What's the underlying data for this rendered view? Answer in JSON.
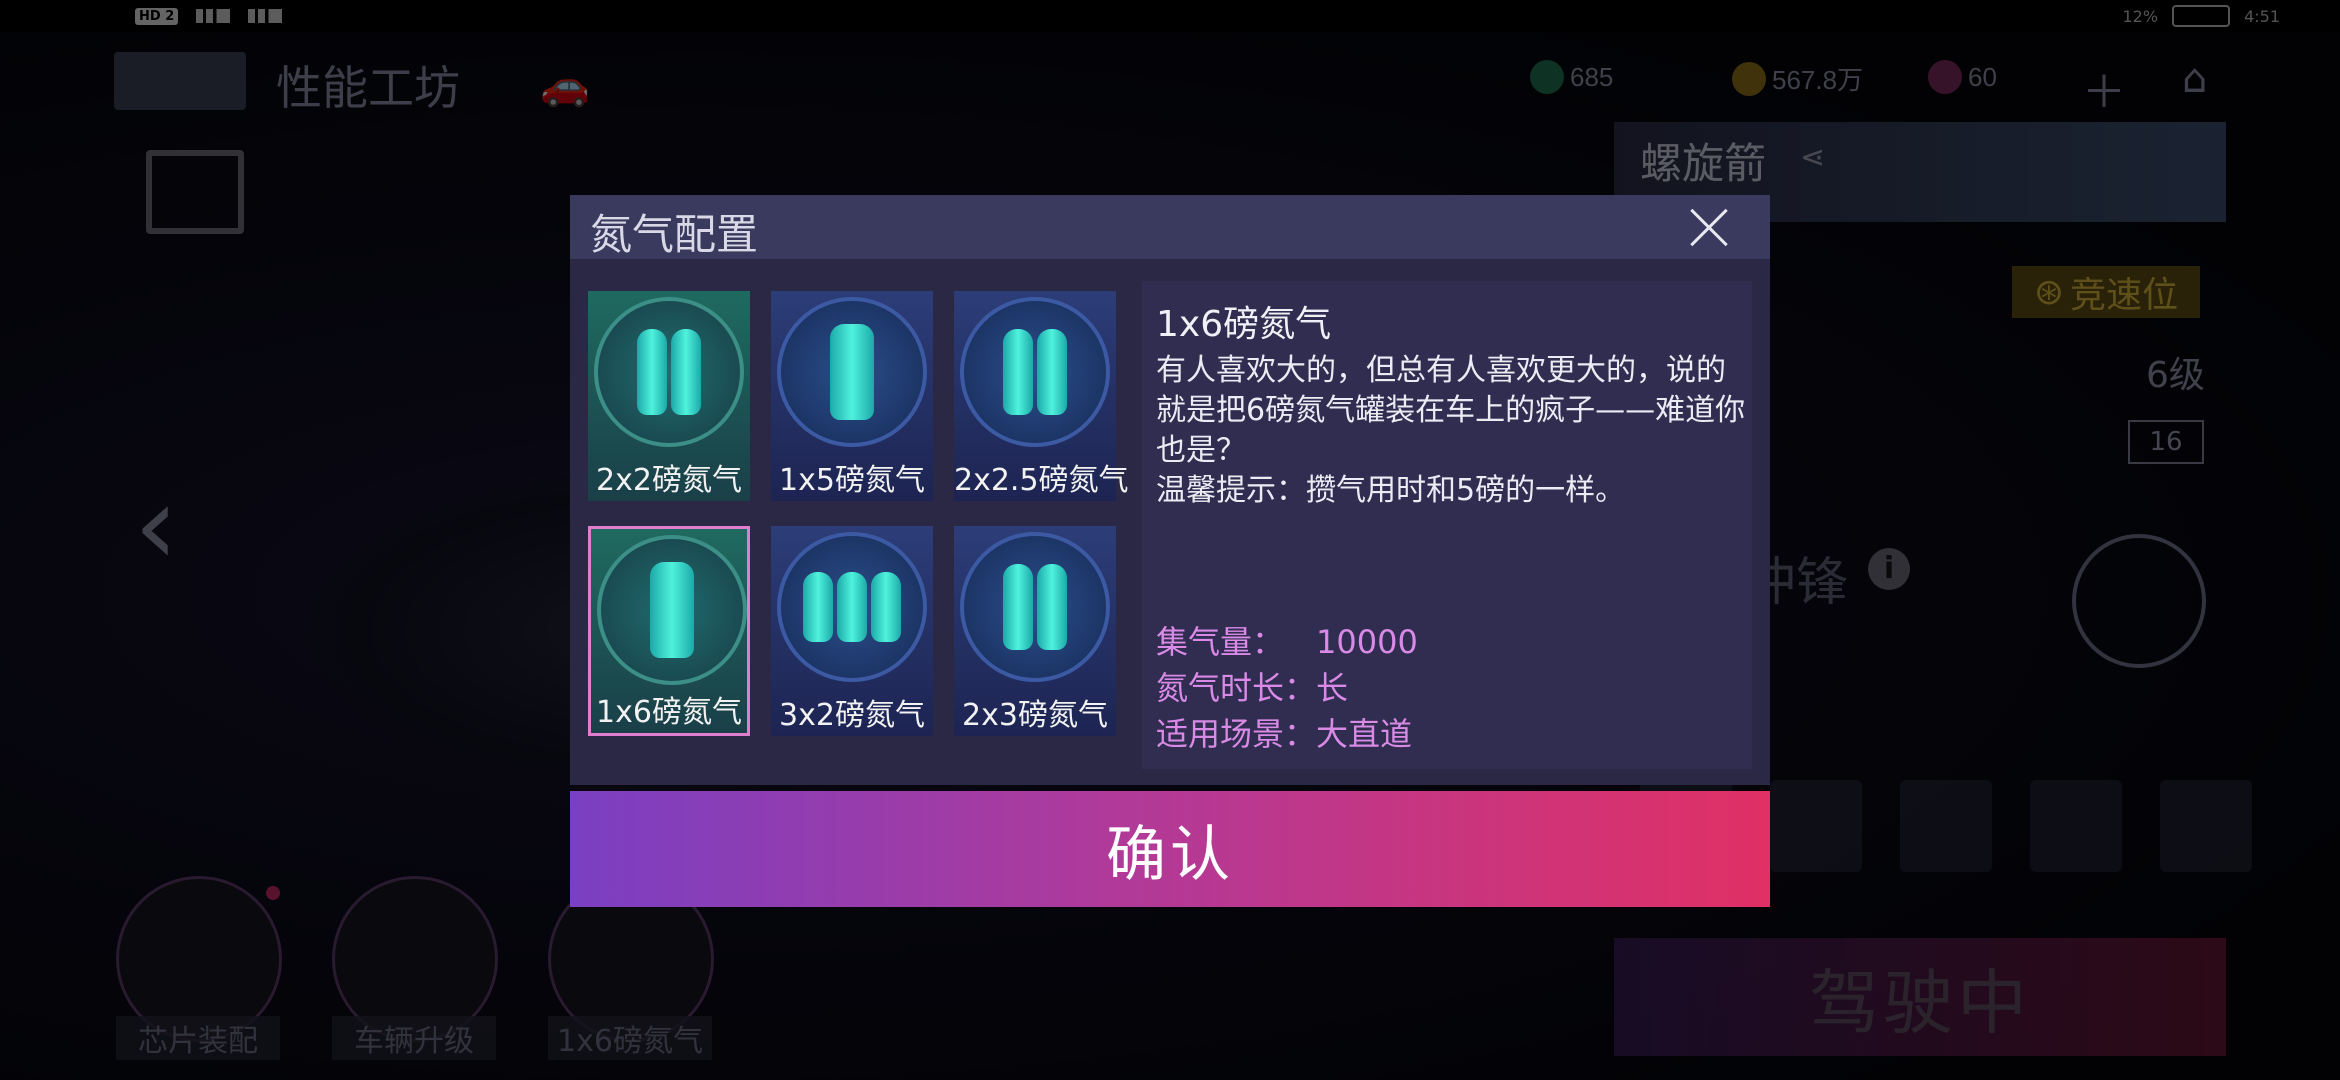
{
  "status_bar": {
    "hd": "HD 2",
    "battery": "12%",
    "time": "4:51"
  },
  "header": {
    "page_title": "性能工坊"
  },
  "currency": [
    {
      "value": "685",
      "color": "#26a36e"
    },
    {
      "value": "567.8万",
      "color": "#c79a1e"
    },
    {
      "value": "60",
      "color": "#a33a7a"
    }
  ],
  "car_panel": {
    "name": "螺旋箭",
    "race_badge": "竞速位",
    "level": "6级",
    "level_badge": "16",
    "skill": "龙卷冲锋",
    "drive_button": "驾驶中"
  },
  "bottom_menu": [
    {
      "label": "芯片装配"
    },
    {
      "label": "车辆升级"
    },
    {
      "label": "1x6磅氮气"
    }
  ],
  "modal": {
    "title": "氮气配置",
    "options": [
      {
        "label": "2x2磅氮气",
        "icon": "twin-tank-icon"
      },
      {
        "label": "1x5磅氮气",
        "icon": "single-tank-icon"
      },
      {
        "label": "2x2.5磅氮气",
        "icon": "twin-tank-icon"
      },
      {
        "label": "1x6磅氮气",
        "icon": "single-tank-icon",
        "selected": true
      },
      {
        "label": "3x2磅氮气",
        "icon": "triple-tank-icon"
      },
      {
        "label": "2x3磅氮气",
        "icon": "twin-tank-icon"
      }
    ],
    "detail": {
      "title": "1x6磅氮气",
      "description": "有人喜欢大的，但总有人喜欢更大的，说的就是把6磅氮气罐装在车上的疯子——难道你也是？",
      "tip": "温馨提示：攒气用时和5磅的一样。",
      "stats": [
        {
          "key": "集气量：",
          "value": "10000"
        },
        {
          "key": "氮气时长：",
          "value": "长"
        },
        {
          "key": "适用场景：",
          "value": "大直道"
        }
      ]
    },
    "confirm_label": "确认"
  }
}
